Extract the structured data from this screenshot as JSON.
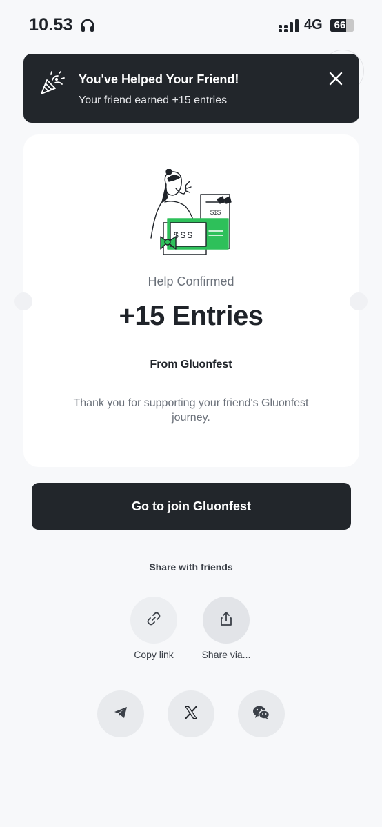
{
  "status_bar": {
    "time": "10.53",
    "network": "4G",
    "battery": "66",
    "battery_level": 0.66
  },
  "toast": {
    "title": "You've Helped Your Friend!",
    "subtitle": "Your friend earned +15 entries"
  },
  "card": {
    "heading": "Help Confirmed",
    "entries": "+15 Entries",
    "source": "From Gluonfest",
    "message": "Thank you for supporting your friend's Gluonfest journey.",
    "illustration": {
      "ticket_text": "$ $ $",
      "receipt_text": "$$$"
    }
  },
  "join_button": {
    "label": "Go to join Gluonfest"
  },
  "share": {
    "title": "Share with friends",
    "copy_link": "Copy link",
    "share_via": "Share via..."
  },
  "icons": [
    "headphones-icon",
    "signal-icon",
    "party-popper-icon",
    "close-icon",
    "link-icon",
    "share-icon",
    "telegram-icon",
    "x-icon",
    "wechat-icon"
  ],
  "colors": {
    "dark": "#22262b",
    "accent_green": "#2ec05a",
    "background": "#f7f8fa"
  }
}
